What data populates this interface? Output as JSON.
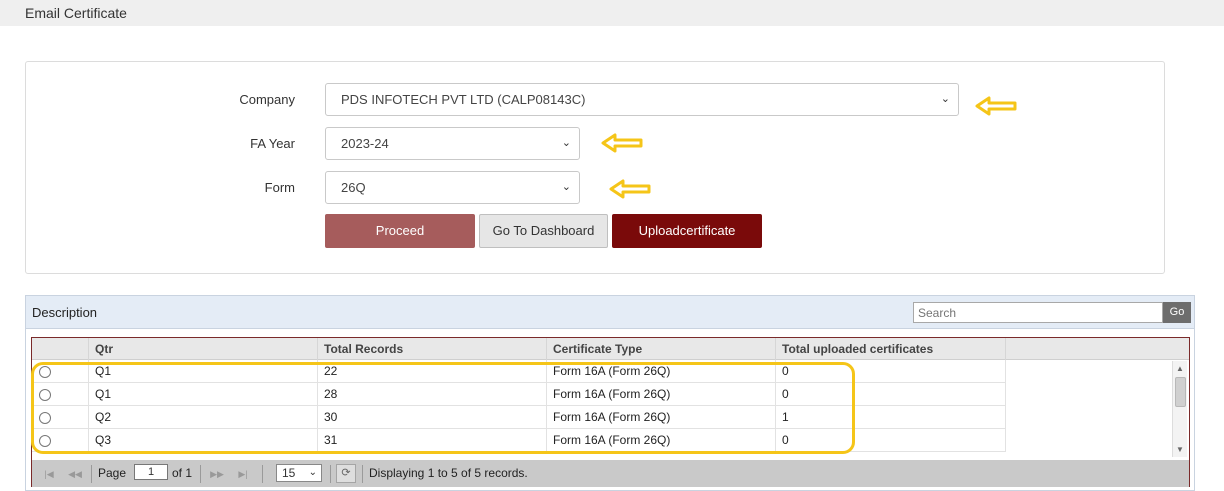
{
  "page": {
    "title": "Email Certificate"
  },
  "form": {
    "company_label": "Company",
    "company_value": "PDS INFOTECH PVT LTD (CALP08143C)",
    "fa_year_label": "FA Year",
    "fa_year_value": "2023-24",
    "form_label": "Form",
    "form_value": "26Q",
    "proceed_label": "Proceed",
    "dashboard_label": "Go To Dashboard",
    "upload_label": "Uploadcertificate"
  },
  "grid": {
    "caption": "Description",
    "search_placeholder": "Search",
    "go_label": "Go",
    "columns": [
      "Qtr",
      "Total Records",
      "Certificate Type",
      "Total uploaded certificates"
    ],
    "rows": [
      {
        "qtr": "Q1",
        "total": "22",
        "type": "Form 16A (Form 26Q)",
        "uploaded": "0"
      },
      {
        "qtr": "Q1",
        "total": "28",
        "type": "Form 16A (Form 26Q)",
        "uploaded": "0"
      },
      {
        "qtr": "Q2",
        "total": "30",
        "type": "Form 16A (Form 26Q)",
        "uploaded": "1"
      },
      {
        "qtr": "Q3",
        "total": "31",
        "type": "Form 16A (Form 26Q)",
        "uploaded": "0"
      }
    ]
  },
  "pager": {
    "page_label": "Page",
    "page_value": "1",
    "of_label": "of 1",
    "rows_per_page": "15",
    "status": "Displaying 1 to 5 of 5 records."
  },
  "colors": {
    "annotation": "#f5c518",
    "proceed": "#a65c5c",
    "upload": "#7a0a0a"
  }
}
